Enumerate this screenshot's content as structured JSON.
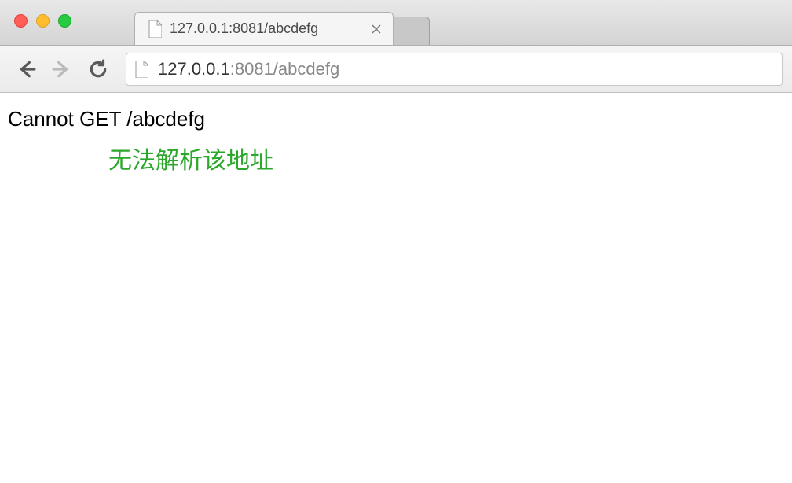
{
  "window": {
    "tab_title": "127.0.0.1:8081/abcdefg"
  },
  "address": {
    "host": "127.0.0.1",
    "port_path": ":8081/abcdefg"
  },
  "page": {
    "error_message": "Cannot GET /abcdefg",
    "annotation": "无法解析该地址"
  }
}
